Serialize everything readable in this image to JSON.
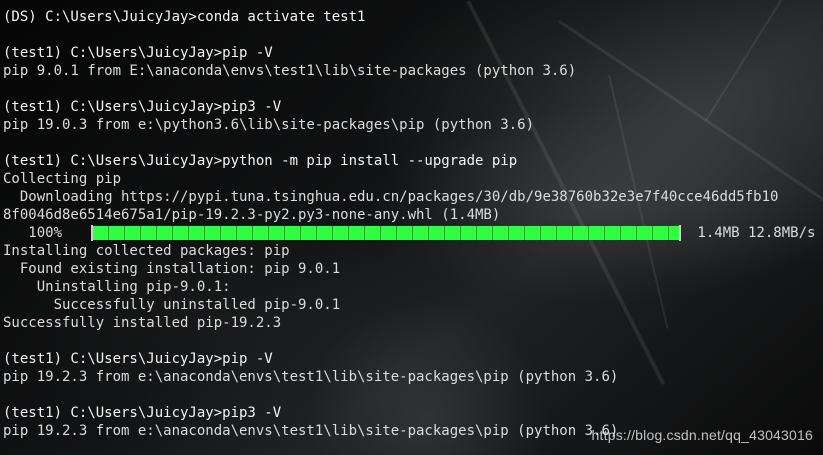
{
  "terminal": {
    "lines": [
      "(DS) C:\\Users\\JuicyJay>conda activate test1",
      "",
      "(test1) C:\\Users\\JuicyJay>pip -V",
      "pip 9.0.1 from E:\\anaconda\\envs\\test1\\lib\\site-packages (python 3.6)",
      "",
      "(test1) C:\\Users\\JuicyJay>pip3 -V",
      "pip 19.0.3 from e:\\python3.6\\lib\\site-packages\\pip (python 3.6)",
      "",
      "(test1) C:\\Users\\JuicyJay>python -m pip install --upgrade pip",
      "Collecting pip",
      "  Downloading https://pypi.tuna.tsinghua.edu.cn/packages/30/db/9e38760b32e3e7f40cce46dd5fb10",
      "8f0046d8e6514e675a1/pip-19.2.3-py2.py3-none-any.whl (1.4MB)",
      "",
      "Installing collected packages: pip",
      "  Found existing installation: pip 9.0.1",
      "    Uninstalling pip-9.0.1:",
      "      Successfully uninstalled pip-9.0.1",
      "Successfully installed pip-19.2.3",
      "",
      "(test1) C:\\Users\\JuicyJay>pip -V",
      "pip 19.2.3 from e:\\anaconda\\envs\\test1\\lib\\site-packages\\pip (python 3.6)",
      "",
      "(test1) C:\\Users\\JuicyJay>pip3 -V",
      "pip 19.2.3 from e:\\anaconda\\envs\\test1\\lib\\site-packages\\pip (python 3.6)"
    ],
    "progress": {
      "percent_text": "   100%",
      "percent_value": 100,
      "size_text": " 1.4MB 12.8MB/s"
    },
    "watermark": "https://blog.csdn.net/qq_43043016"
  }
}
